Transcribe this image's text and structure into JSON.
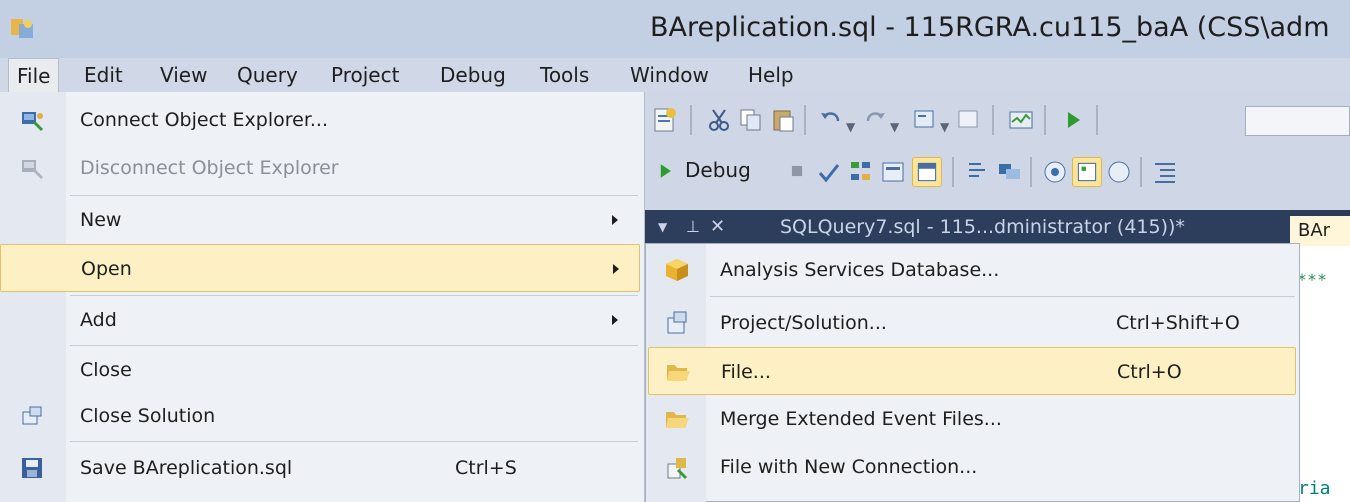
{
  "window": {
    "title": "BAreplication.sql - 115RGRA.cu115_baA (CSS\\adm"
  },
  "menubar": {
    "items": [
      "File",
      "Edit",
      "View",
      "Query",
      "Project",
      "Debug",
      "Tools",
      "Window",
      "Help"
    ]
  },
  "toolbar": {
    "debug_label": "Debug"
  },
  "document": {
    "tab_label": "SQLQuery7.sql - 115...dministrator (415))*",
    "active_tab_label": "BAr",
    "editor_dots": "***",
    "editor_text": "ria"
  },
  "file_menu": {
    "items": [
      {
        "label": "Connect Object Explorer...",
        "icon": "connect-icon"
      },
      {
        "label": "Disconnect Object Explorer",
        "icon": "disconnect-icon",
        "disabled": true
      },
      {
        "label": "New",
        "submenu": true
      },
      {
        "label": "Open",
        "submenu": true,
        "highlighted": true
      },
      {
        "label": "Add",
        "submenu": true
      },
      {
        "label": "Close"
      },
      {
        "label": "Close Solution",
        "icon": "close-solution-icon"
      },
      {
        "label": "Save BAreplication.sql",
        "icon": "save-icon",
        "shortcut": "Ctrl+S"
      }
    ]
  },
  "open_submenu": {
    "items": [
      {
        "label": "Analysis Services Database...",
        "icon": "cube-icon"
      },
      {
        "label": "Project/Solution...",
        "icon": "project-icon",
        "shortcut": "Ctrl+Shift+O"
      },
      {
        "label": "File...",
        "icon": "folder-open-icon",
        "shortcut": "Ctrl+O",
        "highlighted": true
      },
      {
        "label": "Merge Extended Event Files...",
        "icon": "folder-open-icon"
      },
      {
        "label": "File with New Connection...",
        "icon": "file-connection-icon"
      }
    ]
  },
  "colors": {
    "menu_highlight": "#fdf0c4",
    "menu_highlight_border": "#e5c365",
    "title_bar": "#c3cfe3"
  }
}
